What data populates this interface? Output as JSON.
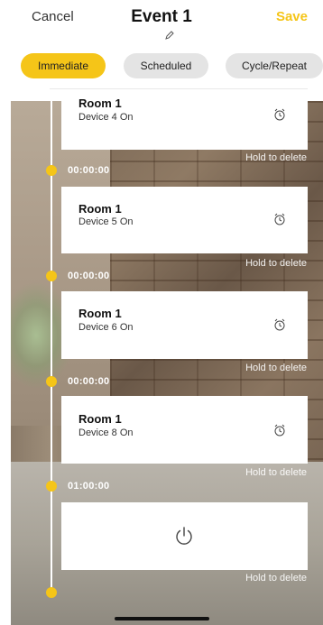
{
  "header": {
    "cancel_label": "Cancel",
    "title": "Event 1",
    "save_label": "Save",
    "edit_icon": "pencil-icon"
  },
  "tabs": [
    {
      "label": "Immediate",
      "selected": true
    },
    {
      "label": "Scheduled",
      "selected": false
    },
    {
      "label": "Cycle/Repeat",
      "selected": false
    }
  ],
  "timeline": {
    "steps": [
      {
        "room": "Room 1",
        "action": "Device 4 On",
        "hold_label": "Hold to delete",
        "time": "00:00:00"
      },
      {
        "room": "Room 1",
        "action": "Device 5 On",
        "hold_label": "Hold to delete",
        "time": "00:00:00"
      },
      {
        "room": "Room 1",
        "action": "Device 6 On",
        "hold_label": "Hold to delete",
        "time": "00:00:00"
      },
      {
        "room": "Room 1",
        "action": "Device 8 On",
        "hold_label": "Hold to delete",
        "time": "01:00:00"
      }
    ],
    "add_step": {
      "icon": "power-icon",
      "hold_label": "Hold to delete"
    }
  },
  "colors": {
    "accent": "#f5c518",
    "save": "#f5c518",
    "dot": "#f5c518",
    "card": "#ffffff",
    "tab_inactive": "#e4e4e4"
  }
}
